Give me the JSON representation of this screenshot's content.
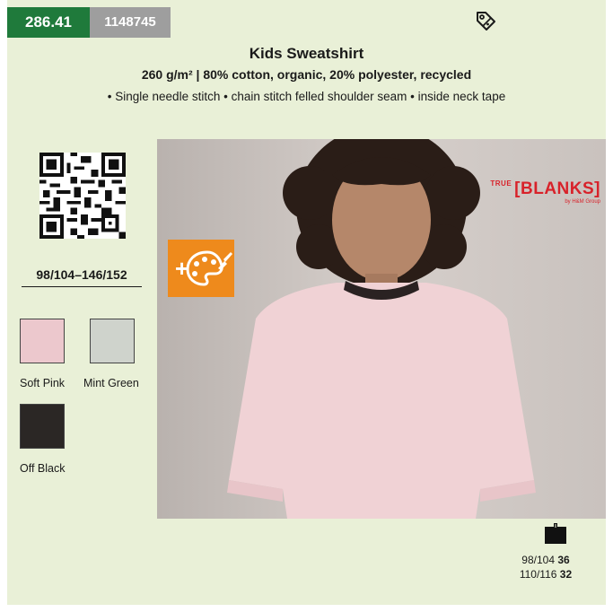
{
  "header": {
    "article_number": "286.41",
    "supplier_code": "1148745",
    "tag_icon": "discount-tag-icon"
  },
  "product": {
    "title": "Kids Sweatshirt",
    "material": "260 g/m² | 80% cotton, organic, 20% polyester, recycled",
    "features": "• Single needle stitch • chain stitch felled shoulder seam • inside neck tape"
  },
  "size_range": "98/104–146/152",
  "colors": [
    {
      "name": "Soft Pink",
      "hex": "#ecc8cd"
    },
    {
      "name": "Mint Green",
      "hex": "#cfd3cc"
    },
    {
      "name": "Off Black",
      "hex": "#2b2725"
    }
  ],
  "brand": {
    "prefix": "TRUE",
    "name": "[BLANKS]",
    "sub": "by H&M Group",
    "color": "#d8222a"
  },
  "badge": {
    "icon": "customization-palette-icon",
    "color": "#ee8a1c"
  },
  "packaging": {
    "icon": "carton-icon",
    "rows": [
      {
        "size": "98/104",
        "qty": "36"
      },
      {
        "size": "110/116",
        "qty": "32"
      }
    ]
  }
}
